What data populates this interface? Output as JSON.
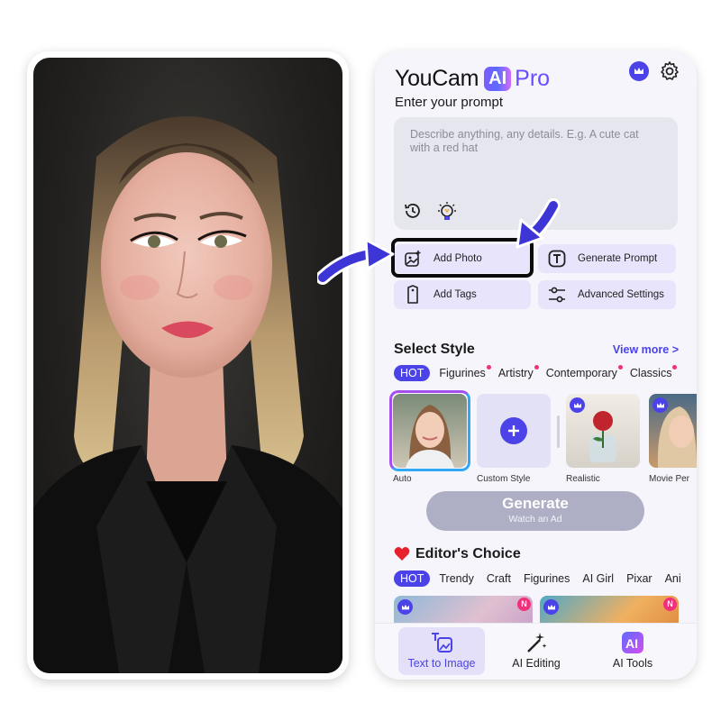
{
  "app": {
    "logo_main": "YouCam",
    "logo_ai": "AI",
    "logo_pro": "Pro"
  },
  "icons": {
    "crown": "crown-icon",
    "settings": "gear-icon",
    "history": "history-icon",
    "bulb": "lightbulb-icon",
    "add_photo": "image-add-icon",
    "generate_prompt": "text-t-icon",
    "add_tags": "tag-icon",
    "advanced_settings": "sliders-icon",
    "plus": "plus-icon",
    "heart": "heart-icon"
  },
  "prompt": {
    "heading": "Enter your prompt",
    "placeholder": "Describe anything, any details. E.g. A cute cat with a red hat"
  },
  "actions": {
    "add_photo": "Add Photo",
    "generate_prompt": "Generate Prompt",
    "add_tags": "Add Tags",
    "advanced_settings": "Advanced Settings"
  },
  "select_style": {
    "title": "Select Style",
    "view_more": "View more >",
    "tabs": [
      "HOT",
      "Figurines",
      "Artistry",
      "Contemporary",
      "Classics"
    ],
    "styles": [
      "Auto",
      "Custom Style",
      "Realistic",
      "Movie Per"
    ]
  },
  "generate": {
    "label": "Generate",
    "sub_label": "Watch an Ad"
  },
  "editors_choice": {
    "title": "Editor's Choice",
    "tabs": [
      "HOT",
      "Trendy",
      "Craft",
      "Figurines",
      "AI Girl",
      "Pixar",
      "Ani"
    ],
    "badge": "N"
  },
  "bottom_nav": [
    "Text to Image",
    "AI Editing",
    "AI Tools"
  ],
  "colors": {
    "accent": "#4b43e8",
    "badge_pink": "#f0307a",
    "arrow_blue": "#3d35d6",
    "generate_disabled": "#aeaec4"
  }
}
